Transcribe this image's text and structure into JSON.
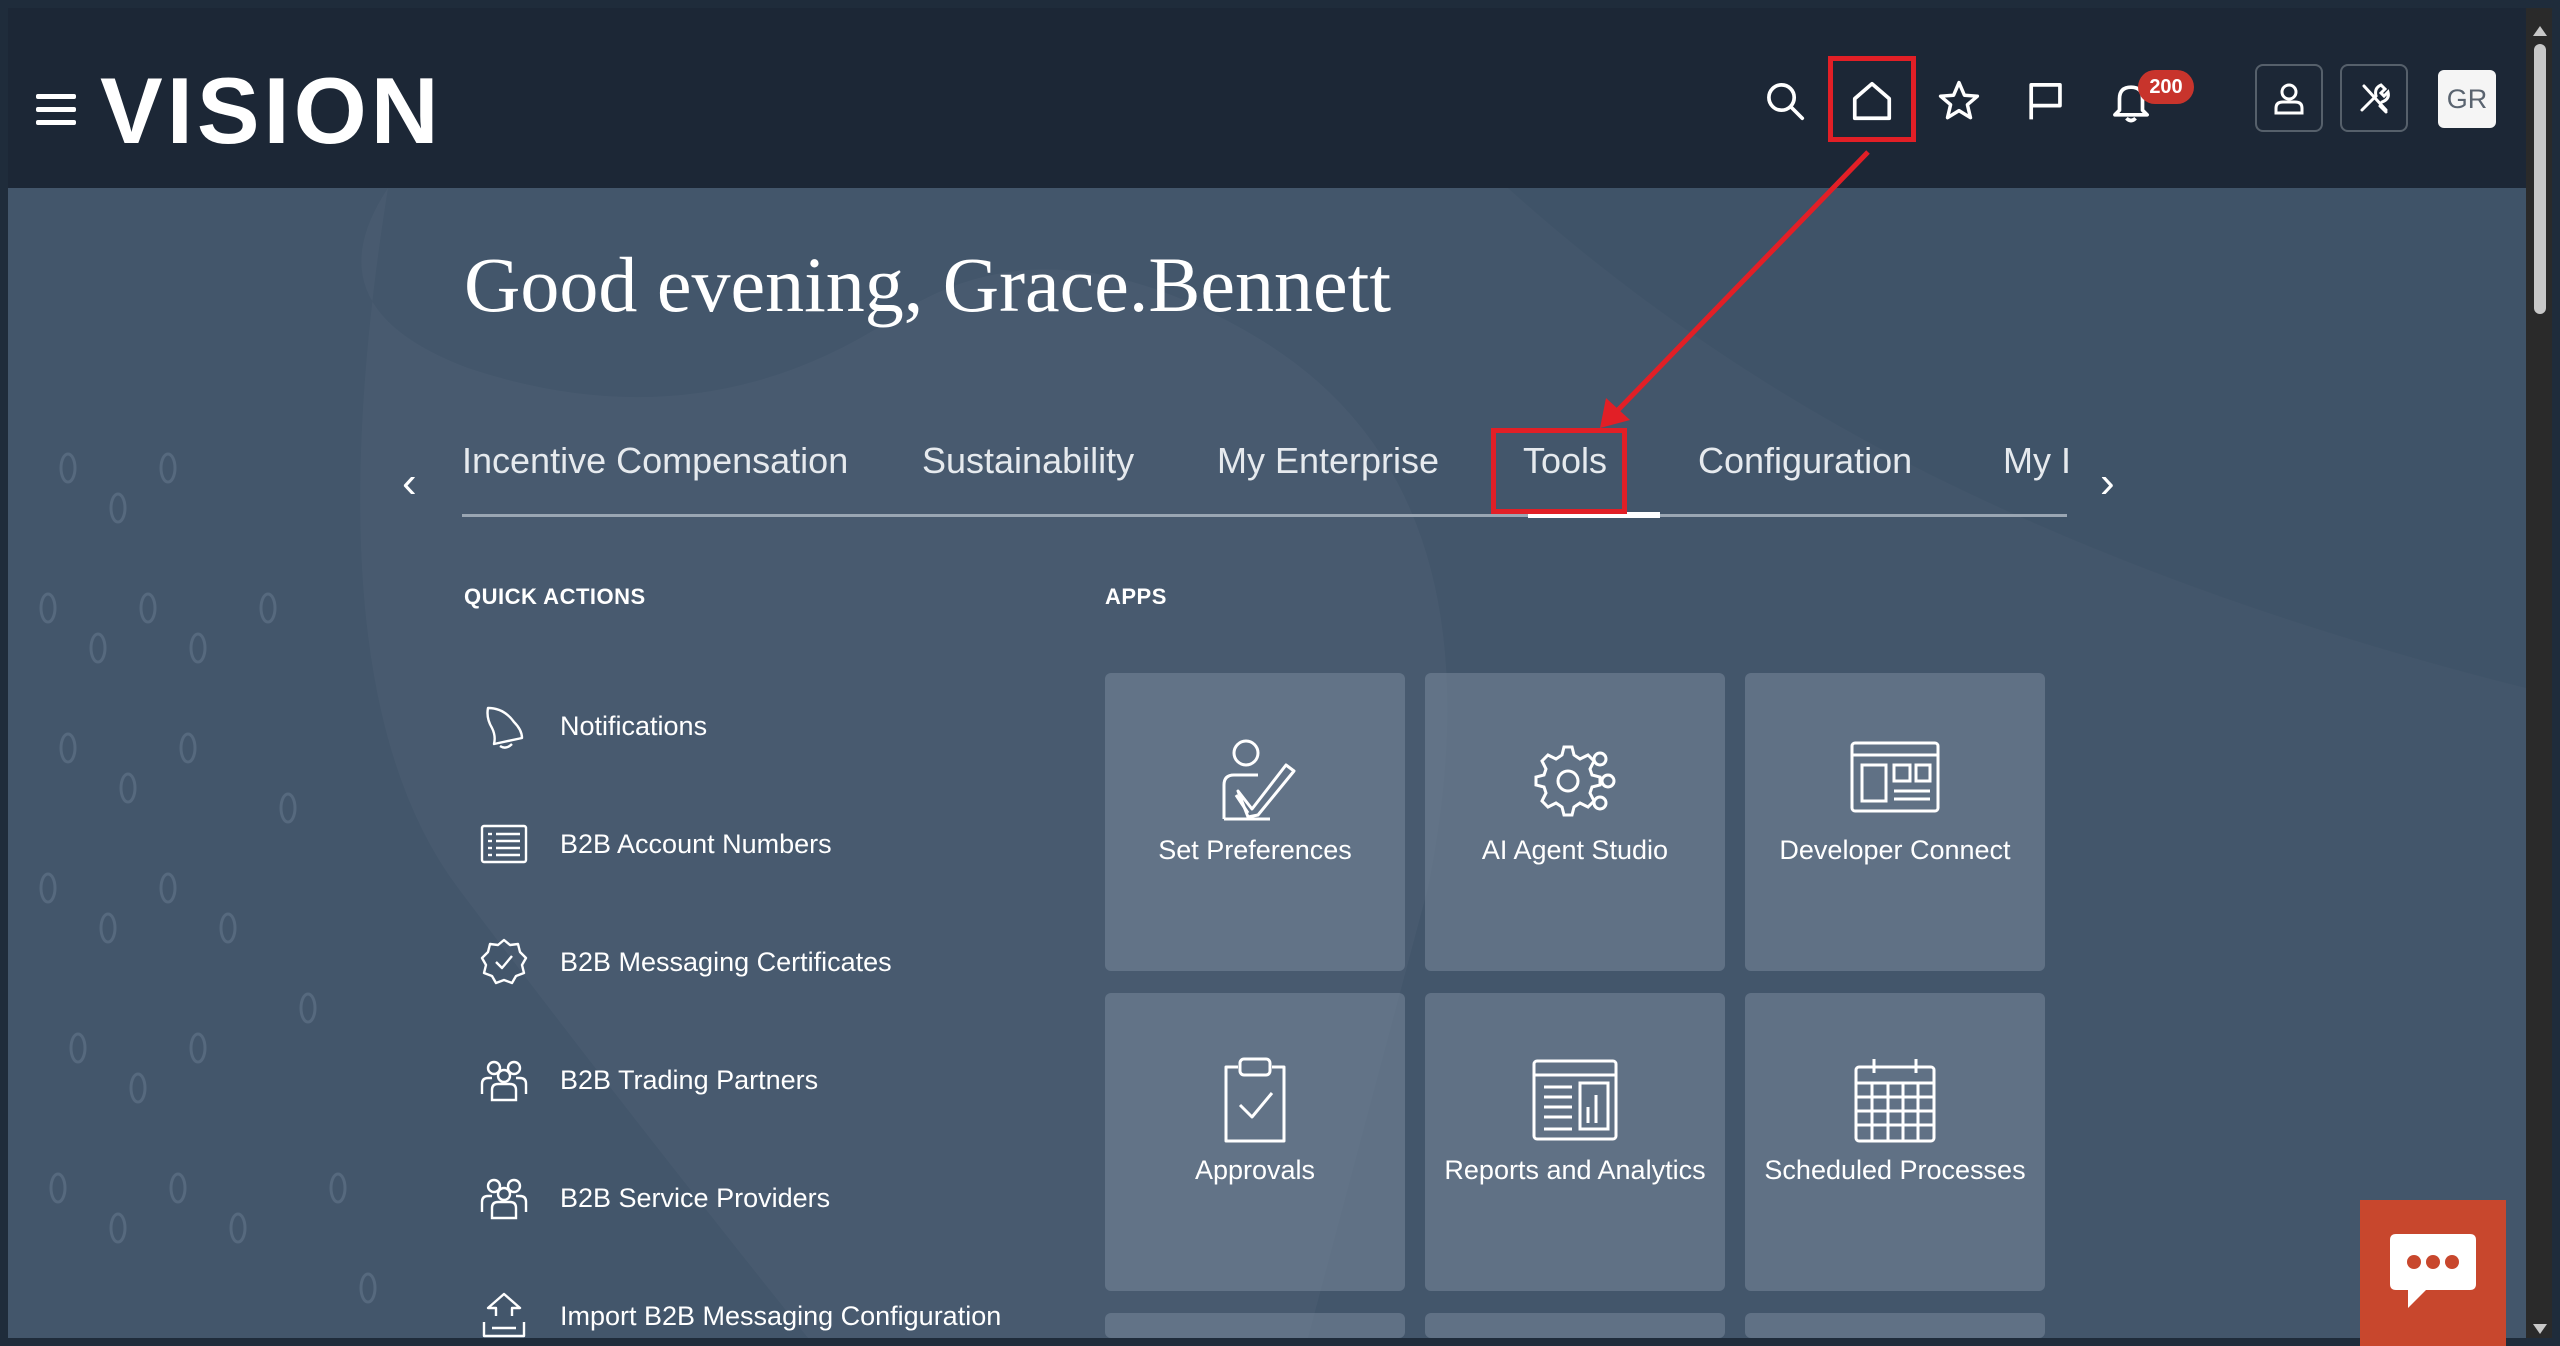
{
  "header": {
    "logo": "VISION",
    "icons": [
      "search-icon",
      "home-icon",
      "star-icon",
      "flag-icon",
      "bell-icon",
      "user-icon",
      "tools-icon"
    ],
    "notification_count": "200",
    "avatar_initials": "GR"
  },
  "greeting": "Good evening, Grace.Bennett",
  "tabs": {
    "items": [
      "Incentive Compensation",
      "Sustainability",
      "My Enterprise",
      "Tools",
      "Configuration",
      "My I"
    ],
    "active": "Tools"
  },
  "quick_actions": {
    "title": "QUICK ACTIONS",
    "items": [
      {
        "label": "Notifications",
        "icon": "bell-outline-icon"
      },
      {
        "label": "B2B Account Numbers",
        "icon": "list-icon"
      },
      {
        "label": "B2B Messaging Certificates",
        "icon": "certificate-icon"
      },
      {
        "label": "B2B Trading Partners",
        "icon": "people-icon"
      },
      {
        "label": "B2B Service Providers",
        "icon": "people-icon"
      },
      {
        "label": "Import B2B Messaging Configuration",
        "icon": "upload-icon"
      }
    ]
  },
  "apps": {
    "title": "APPS",
    "items": [
      {
        "label": "Set Preferences",
        "icon": "person-pen-icon"
      },
      {
        "label": "AI Agent Studio",
        "icon": "ai-gear-icon"
      },
      {
        "label": "Developer Connect",
        "icon": "developer-panel-icon"
      },
      {
        "label": "Approvals",
        "icon": "clipboard-check-icon"
      },
      {
        "label": "Reports and Analytics",
        "icon": "report-chart-icon"
      },
      {
        "label": "Scheduled Processes",
        "icon": "calendar-grid-icon"
      }
    ]
  },
  "colors": {
    "header_bg": "#1c2736",
    "content_bg": "#43566b",
    "highlight": "#e21f26",
    "badge": "#c8342c",
    "chat_button": "#c8472d"
  }
}
